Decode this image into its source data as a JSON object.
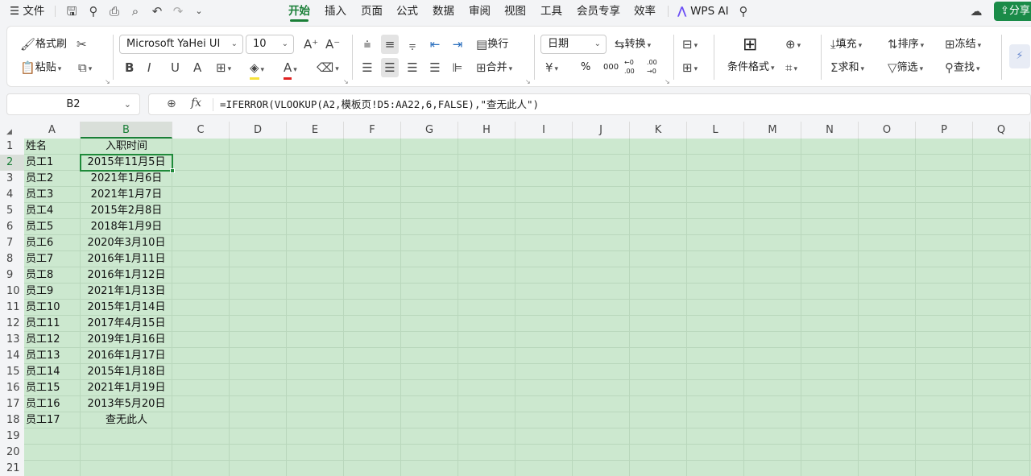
{
  "menubar": {
    "file": "文件",
    "tabs": [
      "开始",
      "插入",
      "页面",
      "公式",
      "数据",
      "审阅",
      "视图",
      "工具",
      "会员专享",
      "效率"
    ],
    "wps_ai": "WPS AI",
    "share": "分享"
  },
  "ribbon": {
    "format_painter": "格式刷",
    "paste": "粘贴",
    "font_name": "Microsoft YaHei UI",
    "font_size": "10",
    "wrap": "换行",
    "merge": "合并",
    "number_format": "日期",
    "convert": "转换",
    "cond_format": "条件格式",
    "fill": "填充",
    "sort": "排序",
    "freeze": "冻结",
    "sum": "求和",
    "filter": "筛选",
    "find": "查找",
    "percent": "%",
    "thousand": "000",
    "dec_inc": "←0 .00",
    "dec_dec": ".00 →0"
  },
  "formula_bar": {
    "cell_ref": "B2",
    "fx": "fx",
    "formula": "=IFERROR(VLOOKUP(A2,模板页!D5:AA22,6,FALSE),\"查无此人\")"
  },
  "sheet": {
    "columns": [
      "A",
      "B",
      "C",
      "D",
      "E",
      "F",
      "G",
      "H",
      "I",
      "J",
      "K",
      "L",
      "M",
      "N",
      "O",
      "P",
      "Q"
    ],
    "row_numbers": [
      "1",
      "2",
      "3",
      "4",
      "5",
      "6",
      "7",
      "8",
      "9",
      "10",
      "11",
      "12",
      "13",
      "14",
      "15",
      "16",
      "17",
      "18",
      "19",
      "20",
      "21"
    ],
    "selected_cell": "B2",
    "rows": [
      [
        "姓名",
        "入职时间"
      ],
      [
        "员工1",
        "2015年11月5日"
      ],
      [
        "员工2",
        "2021年1月6日"
      ],
      [
        "员工3",
        "2021年1月7日"
      ],
      [
        "员工4",
        "2015年2月8日"
      ],
      [
        "员工5",
        "2018年1月9日"
      ],
      [
        "员工6",
        "2020年3月10日"
      ],
      [
        "员工7",
        "2016年1月11日"
      ],
      [
        "员工8",
        "2016年1月12日"
      ],
      [
        "员工9",
        "2021年1月13日"
      ],
      [
        "员工10",
        "2015年1月14日"
      ],
      [
        "员工11",
        "2017年4月15日"
      ],
      [
        "员工12",
        "2019年1月16日"
      ],
      [
        "员工13",
        "2016年1月17日"
      ],
      [
        "员工14",
        "2015年1月18日"
      ],
      [
        "员工15",
        "2021年1月19日"
      ],
      [
        "员工16",
        "2013年5月20日"
      ],
      [
        "员工17",
        "查无此人"
      ]
    ]
  },
  "colors": {
    "accent": "#1a7f37",
    "grid_bg": "#cce8cf"
  }
}
